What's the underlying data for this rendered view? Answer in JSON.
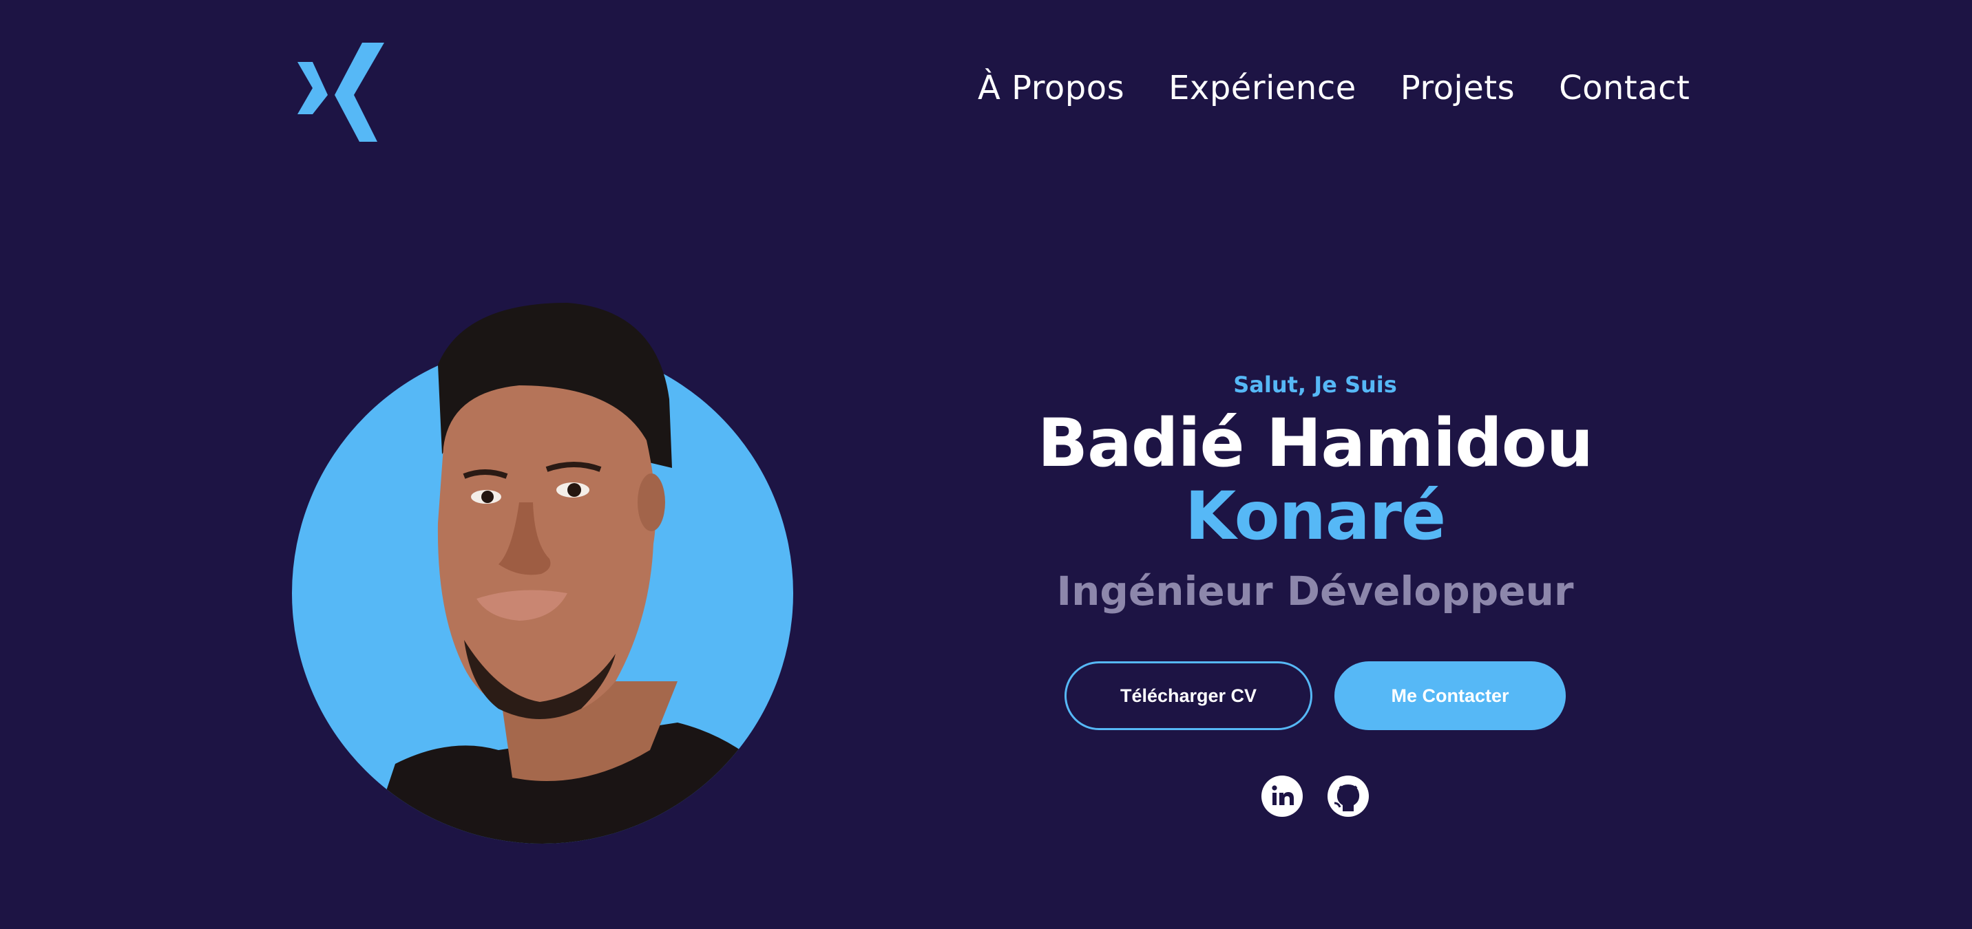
{
  "header": {
    "logo_icon": "stylized-k-logo-icon",
    "nav": [
      {
        "label": "À Propos"
      },
      {
        "label": "Expérience"
      },
      {
        "label": "Projets"
      },
      {
        "label": "Contact"
      }
    ]
  },
  "hero": {
    "greeting": "Salut, Je Suis",
    "name_first": "Badié Hamidou",
    "name_accent": "Konaré",
    "role": "Ingénieur Développeur",
    "buttons": {
      "download_cv": "Télécharger CV",
      "contact": "Me Contacter"
    },
    "socials": [
      {
        "icon": "linkedin-icon"
      },
      {
        "icon": "github-icon"
      }
    ]
  },
  "colors": {
    "background": "#1d1444",
    "accent": "#56b8f6",
    "muted_text": "#8d87ab",
    "text": "#ffffff"
  }
}
